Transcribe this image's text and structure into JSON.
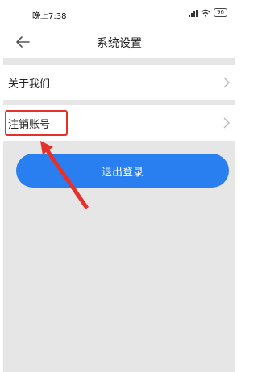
{
  "status_bar": {
    "time": "晚上7:38",
    "battery": "96"
  },
  "header": {
    "title": "系统设置"
  },
  "menu": [
    {
      "label": "关于我们"
    },
    {
      "label": "注销账号"
    }
  ],
  "logout_button": {
    "label": "退出登录"
  },
  "colors": {
    "primary": "#2a7ff0",
    "highlight": "#e8302b",
    "background": "#e6e6e6"
  }
}
